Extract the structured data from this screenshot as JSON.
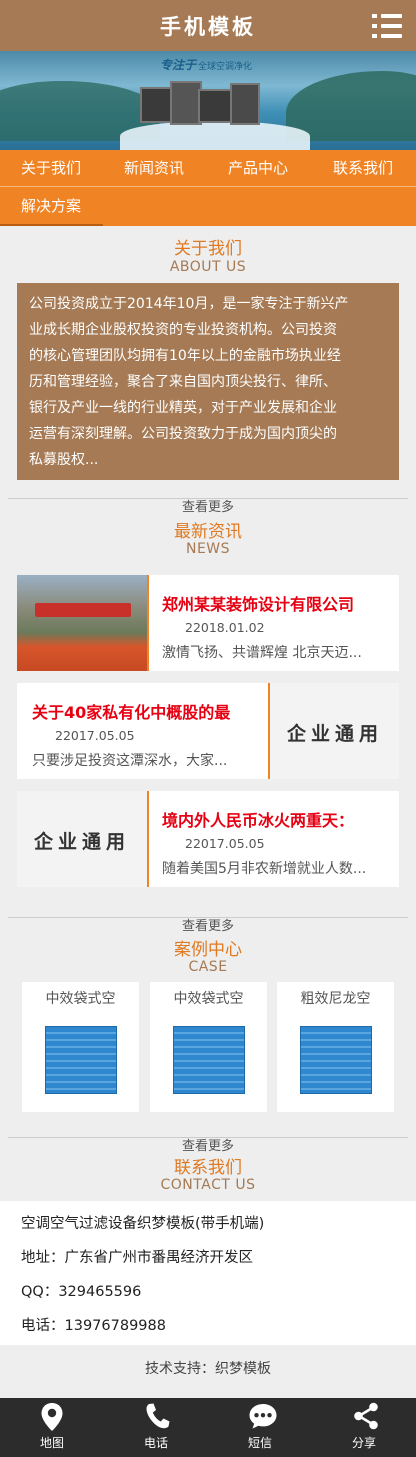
{
  "header": {
    "title": "手机模板",
    "menu_icon": "hamburger-menu-icon"
  },
  "banner": {
    "brand_script": "专注于",
    "brand_tag": "全球空调净化"
  },
  "nav": {
    "items": [
      "关于我们",
      "新闻资讯",
      "产品中心",
      "联系我们",
      "解决方案"
    ],
    "accent": "#f08323"
  },
  "about": {
    "title": "关于我们",
    "subtitle": "ABOUT US",
    "lines": [
      "公司投资成立于2014年10月，是一家专注于新兴产",
      "业成长期企业股权投资的专业投资机构。公司投资",
      "的核心管理团队均拥有10年以上的金融市场执业经",
      "历和管理经验，聚合了来自国内顶尖投行、律所、",
      "银行及产业一线的行业精英，对于产业发展和企业",
      "运营有深刻理解。公司投资致力于成为国内顶尖的",
      "私募股权..."
    ],
    "more": "查看更多"
  },
  "news": {
    "title": "最新资讯",
    "subtitle": "NEWS",
    "items": [
      {
        "title": "郑州某某装饰设计有限公司",
        "date": "22018.01.02",
        "summary": "激情飞扬、共谱辉煌 北京天迈..."
      },
      {
        "title": "关于40家私有化中概股的最",
        "date": "22017.05.05",
        "summary": "只要涉足投资这潭深水，大家...",
        "thumb_text": "企业通用"
      },
      {
        "title": "境内外人民币冰火两重天：",
        "date": "22017.05.05",
        "summary": "随着美国5月非农新增就业人数...",
        "thumb_text": "企业通用"
      }
    ],
    "more": "查看更多"
  },
  "cases": {
    "title": "案例中心",
    "subtitle": "CASE",
    "items": [
      "中效袋式空",
      "中效袋式空",
      "粗效尼龙空"
    ],
    "more": "查看更多"
  },
  "contact": {
    "title": "联系我们",
    "subtitle": "CONTACT US",
    "company": "空调空气过滤设备织梦模板(带手机端)",
    "address": "地址：广东省广州市番禺经济开发区",
    "qq": "QQ：329465596",
    "phone": "电话：13976789988"
  },
  "support": "技术支持：织梦模板",
  "tabbar": [
    {
      "label": "地图",
      "icon": "map-pin-icon"
    },
    {
      "label": "电话",
      "icon": "phone-icon"
    },
    {
      "label": "短信",
      "icon": "message-icon"
    },
    {
      "label": "分享",
      "icon": "share-icon"
    }
  ]
}
